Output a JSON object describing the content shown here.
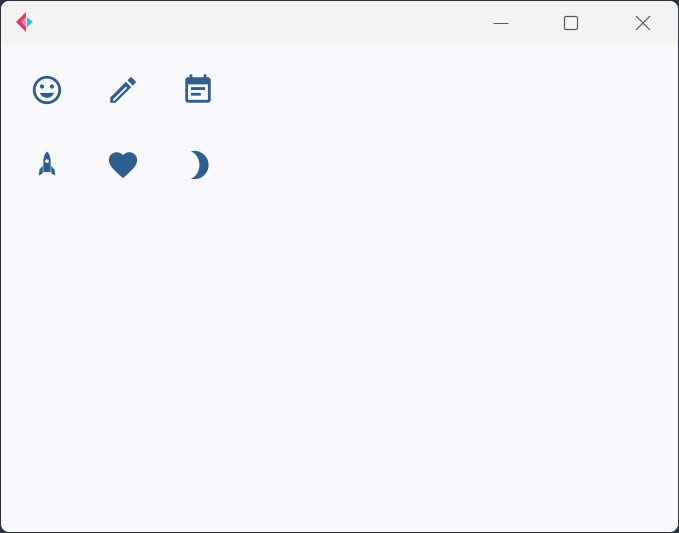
{
  "window": {
    "title": "",
    "controls": [
      {
        "name": "minimize-button",
        "icon": "minimize-icon"
      },
      {
        "name": "maximize-button",
        "icon": "maximize-icon"
      },
      {
        "name": "close-button",
        "icon": "close-icon"
      }
    ]
  },
  "app": {
    "logo_icon": "app-logo-icon",
    "logo_colors": [
      "#e8336b",
      "#3cb8e8"
    ]
  },
  "content": {
    "icon_color": "#2f5f91",
    "icons": [
      [
        "smiley-face-icon",
        "pencil-icon",
        "calendar-icon"
      ],
      [
        "rocket-icon",
        "heart-icon",
        "crescent-moon-icon"
      ]
    ]
  }
}
